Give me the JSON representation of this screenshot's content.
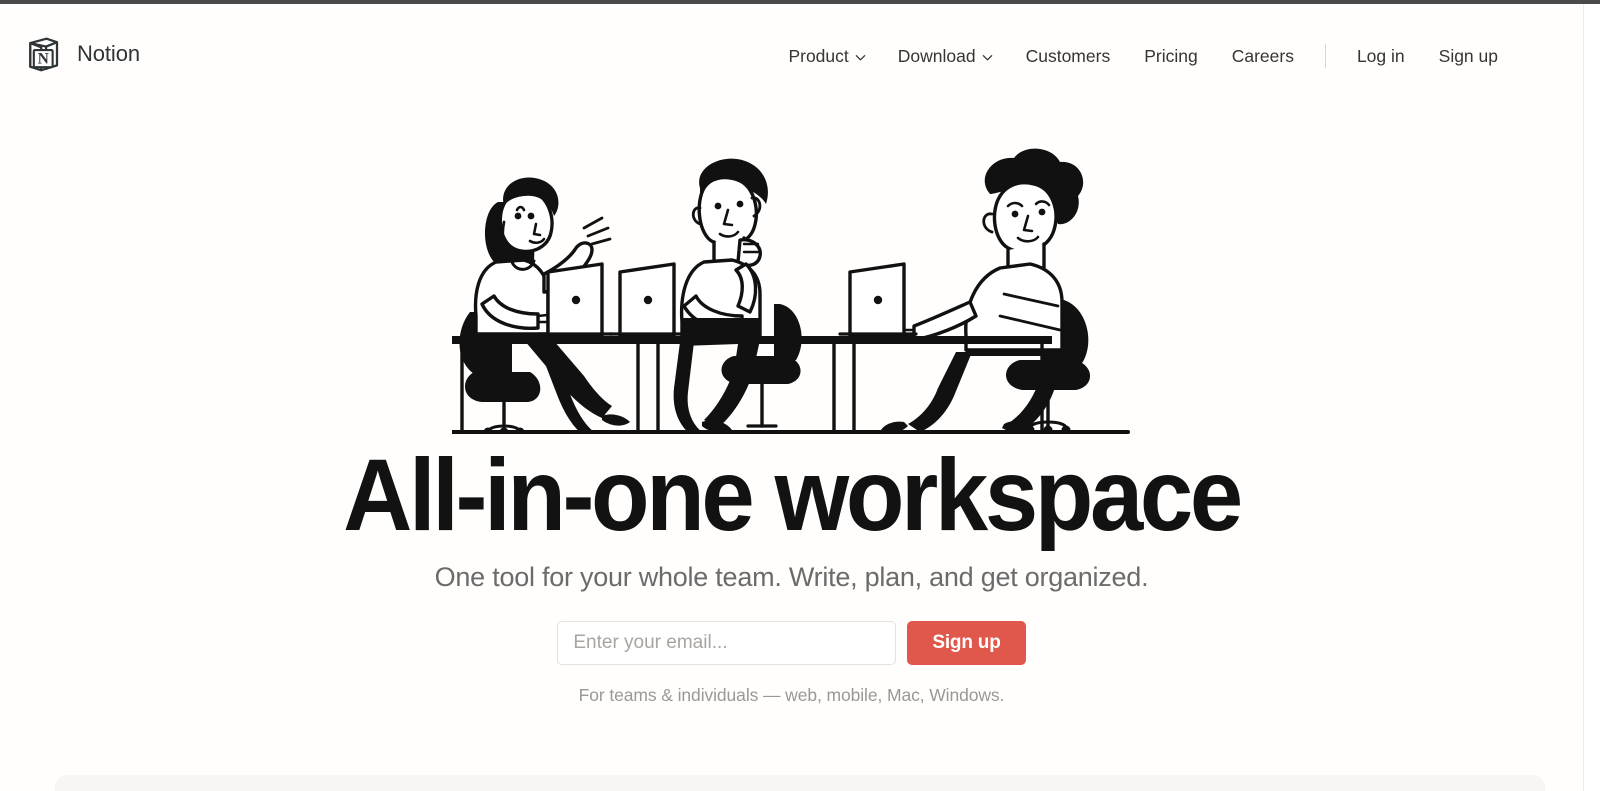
{
  "brand": {
    "name": "Notion",
    "logo_icon": "notion-cube-icon"
  },
  "nav": {
    "items": [
      {
        "label": "Product",
        "has_dropdown": true,
        "icon": "chevron-down-icon"
      },
      {
        "label": "Download",
        "has_dropdown": true,
        "icon": "chevron-down-icon"
      },
      {
        "label": "Customers",
        "has_dropdown": false,
        "icon": ""
      },
      {
        "label": "Pricing",
        "has_dropdown": false,
        "icon": ""
      },
      {
        "label": "Careers",
        "has_dropdown": false,
        "icon": ""
      }
    ],
    "login_label": "Log in",
    "signup_label": "Sign up"
  },
  "hero": {
    "illustration_name": "three-people-at-desks-with-laptops-illustration",
    "title": "All-in-one workspace",
    "subtitle": "One tool for your whole team. Write, plan, and get organized.",
    "email_placeholder": "Enter your email...",
    "email_value": "",
    "cta_label": "Sign up",
    "fineprint": "For teams & individuals — web, mobile, Mac, Windows."
  },
  "colors": {
    "accent": "#e0574b",
    "text": "#37352f",
    "muted": "#9b9892",
    "page_bg": "#fffefc",
    "panel_bg": "#f8f6f2"
  }
}
